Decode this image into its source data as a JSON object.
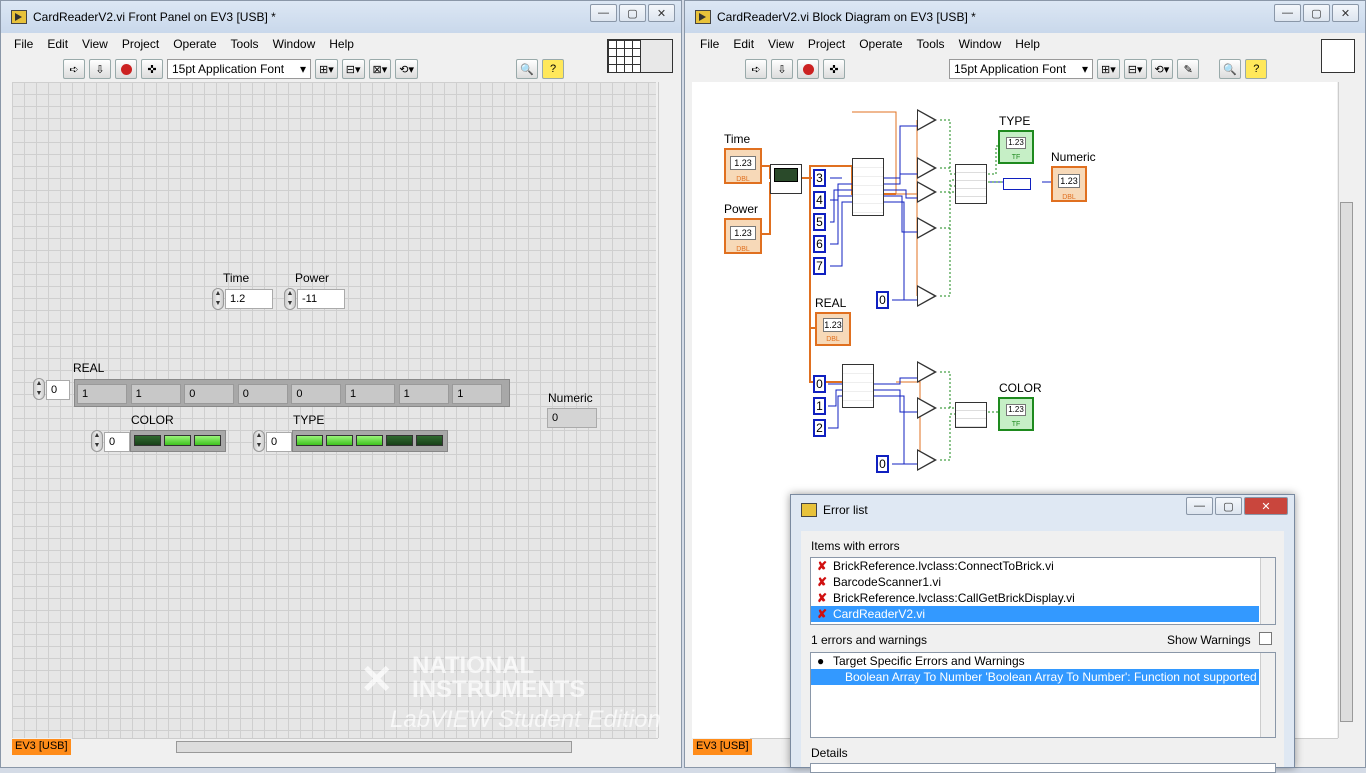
{
  "front_panel": {
    "title": "CardReaderV2.vi Front Panel on EV3 [USB] *",
    "menu": [
      "File",
      "Edit",
      "View",
      "Project",
      "Operate",
      "Tools",
      "Window",
      "Help"
    ],
    "font": "15pt Application Font",
    "time_label": "Time",
    "time_value": "1.2",
    "power_label": "Power",
    "power_value": "-11",
    "real_label": "REAL",
    "real_index": "0",
    "real_values": [
      "1",
      "1",
      "0",
      "0",
      "0",
      "1",
      "1",
      "1"
    ],
    "color_label": "COLOR",
    "color_index": "0",
    "color_leds": [
      false,
      true,
      true
    ],
    "type_label": "TYPE",
    "type_index": "0",
    "type_leds": [
      true,
      true,
      true,
      false,
      false
    ],
    "numeric_label": "Numeric",
    "numeric_value": "0",
    "target": "EV3 [USB]",
    "watermark_line1": "NATIONAL",
    "watermark_line2": "INSTRUMENTS",
    "watermark_line3": "LabVIEW Student Edition"
  },
  "block_diagram": {
    "title": "CardReaderV2.vi Block Diagram on EV3 [USB] *",
    "menu": [
      "File",
      "Edit",
      "View",
      "Project",
      "Operate",
      "Tools",
      "Window",
      "Help"
    ],
    "font": "15pt Application Font",
    "labels": {
      "time": "Time",
      "power": "Power",
      "real": "REAL",
      "type": "TYPE",
      "numeric": "Numeric",
      "color": "COLOR"
    },
    "constants_top": [
      "3",
      "4",
      "5",
      "6",
      "7"
    ],
    "constants_bottom": [
      "0",
      "1",
      "2"
    ],
    "zero_const": "0",
    "term_123": "1.23",
    "term_dbl": "DBL",
    "term_tf": "TF",
    "target": "EV3 [USB]"
  },
  "error_list": {
    "title": "Error list",
    "items_header": "Items with errors",
    "items": [
      {
        "label": "BrickReference.lvclass:ConnectToBrick.vi",
        "selected": false
      },
      {
        "label": "BarcodeScanner1.vi",
        "selected": false
      },
      {
        "label": "BrickReference.lvclass:CallGetBrickDisplay.vi",
        "selected": false
      },
      {
        "label": "CardReaderV2.vi",
        "selected": true
      }
    ],
    "summary": "1 errors and warnings",
    "show_warnings": "Show Warnings",
    "errors_group": "Target Specific Errors and Warnings",
    "error_msg": "Boolean Array To Number 'Boolean Array To Number': Function not supported",
    "details": "Details"
  }
}
